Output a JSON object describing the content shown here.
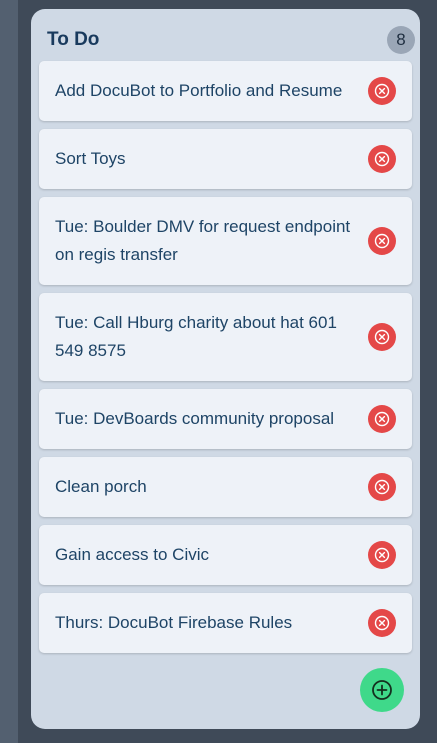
{
  "column": {
    "title": "To Do",
    "count": "8"
  },
  "cards": [
    {
      "text": "Add DocuBot to Portfolio and Resume"
    },
    {
      "text": "Sort Toys"
    },
    {
      "text": "Tue: Boulder DMV for request endpoint on regis transfer"
    },
    {
      "text": "Tue: Call Hburg charity about hat 601 549 8575"
    },
    {
      "text": "Tue: DevBoards community proposal"
    },
    {
      "text": "Clean porch"
    },
    {
      "text": "Gain access to Civic"
    },
    {
      "text": "Thurs: DocuBot Firebase Rules"
    }
  ],
  "icons": {
    "delete": "close-circle-icon",
    "add": "plus-circle-icon"
  },
  "colors": {
    "delete": "#e44848",
    "add": "#3fd98a",
    "title": "#193a5d"
  }
}
